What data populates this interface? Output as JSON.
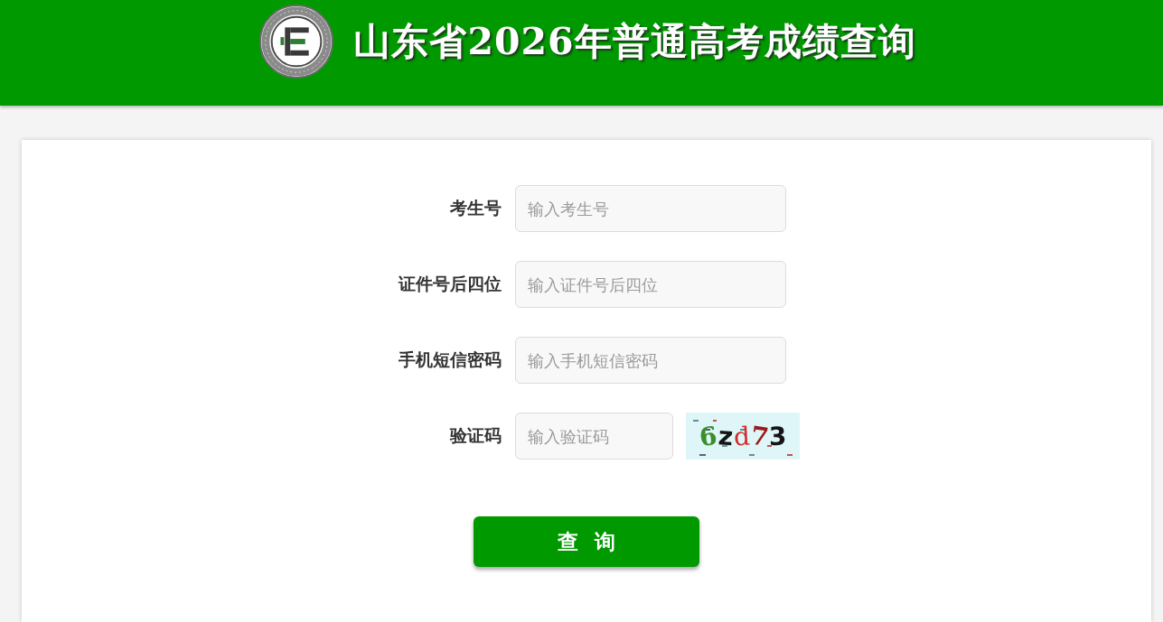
{
  "header": {
    "title": "山东省2026年普通高考成绩查询"
  },
  "form": {
    "fields": [
      {
        "kind": "text",
        "label": "考生号",
        "placeholder": "输入考生号"
      },
      {
        "kind": "text",
        "label": "证件号后四位",
        "placeholder": "输入证件号后四位"
      },
      {
        "kind": "text",
        "label": "手机短信密码",
        "placeholder": "输入手机短信密码"
      },
      {
        "kind": "captcha",
        "label": "验证码",
        "placeholder": "输入验证码",
        "captcha_code": "6zd73"
      }
    ]
  },
  "submit_button": {
    "label": "查 询"
  }
}
